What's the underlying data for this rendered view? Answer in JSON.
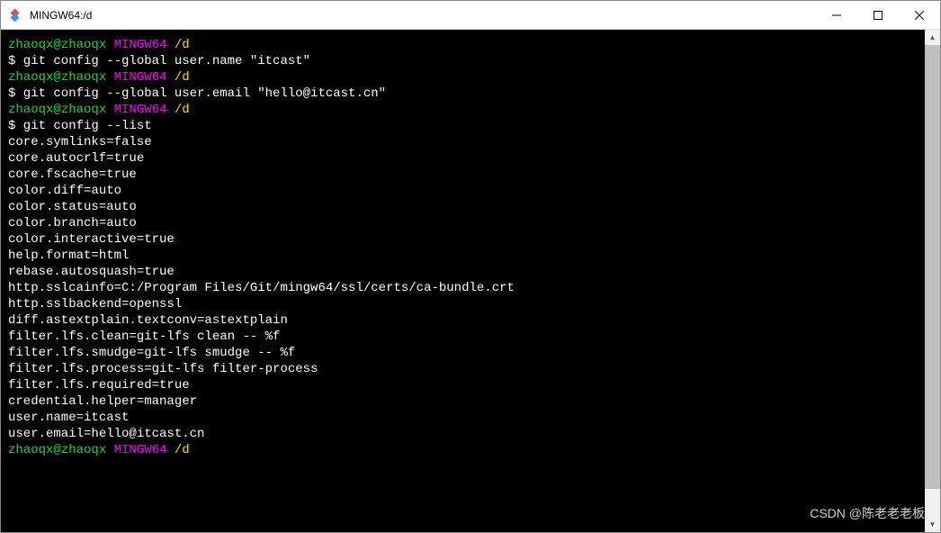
{
  "window": {
    "title": "MINGW64:/d"
  },
  "prompt": {
    "user_host": "zhaoqx@zhaoqx",
    "env": "MINGW64",
    "path": "/d"
  },
  "blocks": [
    {
      "cmd": "$ git config --global user.name \"itcast\"",
      "out": []
    },
    {
      "cmd": "$ git config --global user.email \"hello@itcast.cn\"",
      "out": []
    },
    {
      "cmd": "$ git config --list",
      "out": [
        "core.symlinks=false",
        "core.autocrlf=true",
        "core.fscache=true",
        "color.diff=auto",
        "color.status=auto",
        "color.branch=auto",
        "color.interactive=true",
        "help.format=html",
        "rebase.autosquash=true",
        "http.sslcainfo=C:/Program Files/Git/mingw64/ssl/certs/ca-bundle.crt",
        "http.sslbackend=openssl",
        "diff.astextplain.textconv=astextplain",
        "filter.lfs.clean=git-lfs clean -- %f",
        "filter.lfs.smudge=git-lfs smudge -- %f",
        "filter.lfs.process=git-lfs filter-process",
        "filter.lfs.required=true",
        "credential.helper=manager",
        "user.name=itcast",
        "user.email=hello@itcast.cn"
      ]
    }
  ],
  "watermark": "CSDN @陈老老老板"
}
